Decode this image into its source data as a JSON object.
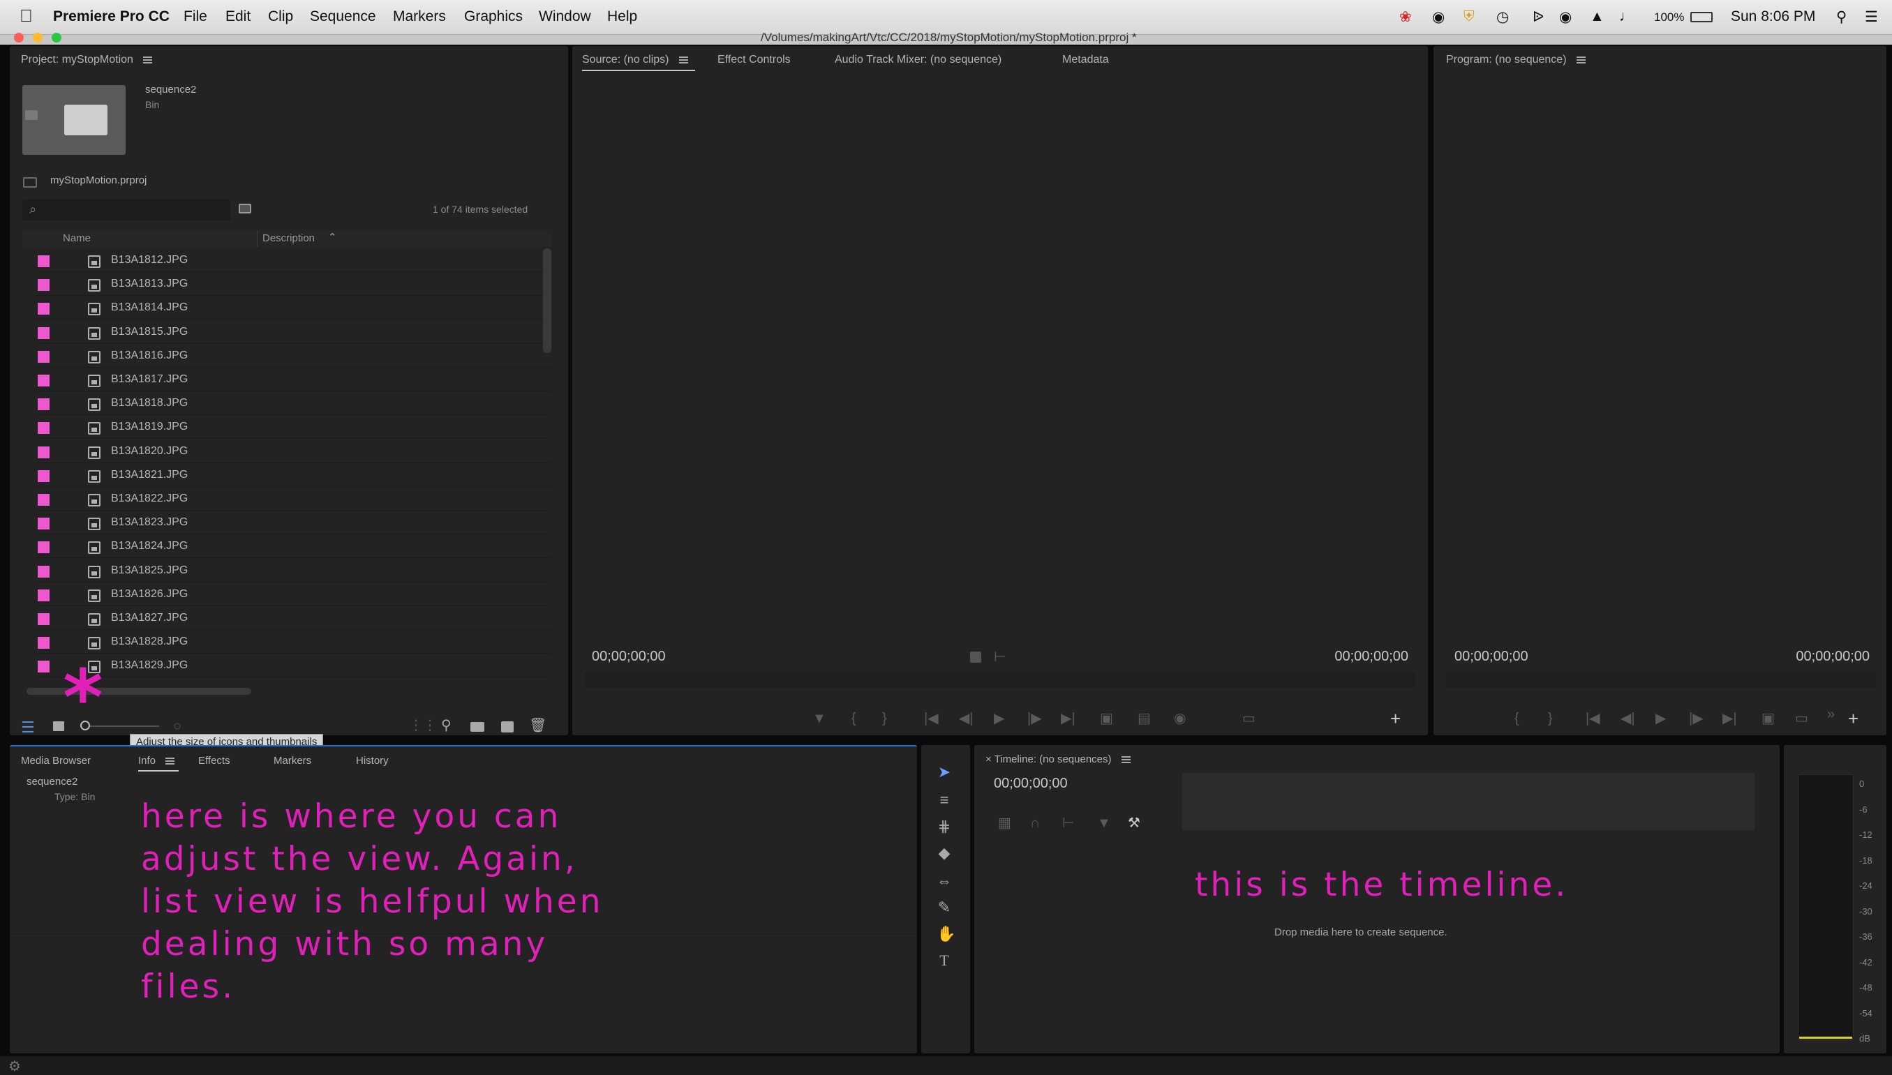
{
  "menubar": {
    "app_name": "Premiere Pro CC",
    "items": [
      "File",
      "Edit",
      "Clip",
      "Sequence",
      "Markers",
      "Graphics",
      "Window",
      "Help"
    ],
    "battery": "100%",
    "clock": "Sun 8:06 PM"
  },
  "window": {
    "title": "/Volumes/makingArt/Vtc/CC/2018/myStopMotion/myStopMotion.prproj *"
  },
  "project_panel": {
    "title": "Project: myStopMotion",
    "bin_name": "sequence2",
    "bin_type": "Bin",
    "project_file": "myStopMotion.prproj",
    "search_placeholder": "",
    "selection_count": "1 of 74 items selected",
    "columns": {
      "name": "Name",
      "description": "Description"
    },
    "items": [
      "B13A1812.JPG",
      "B13A1813.JPG",
      "B13A1814.JPG",
      "B13A1815.JPG",
      "B13A1816.JPG",
      "B13A1817.JPG",
      "B13A1818.JPG",
      "B13A1819.JPG",
      "B13A1820.JPG",
      "B13A1821.JPG",
      "B13A1822.JPG",
      "B13A1823.JPG",
      "B13A1824.JPG",
      "B13A1825.JPG",
      "B13A1826.JPG",
      "B13A1827.JPG",
      "B13A1828.JPG",
      "B13A1829.JPG"
    ],
    "label_color": "#ee58cf",
    "tooltip": "Adjust the size of icons and thumbnails"
  },
  "source_panel": {
    "tabs": [
      "Source: (no clips)",
      "Effect Controls",
      "Audio Track Mixer: (no sequence)",
      "Metadata"
    ],
    "timecode_in": "00;00;00;00",
    "timecode_out": "00;00;00;00"
  },
  "program_panel": {
    "title": "Program: (no sequence)",
    "timecode_in": "00;00;00;00",
    "timecode_out": "00;00;00;00"
  },
  "info_panel": {
    "tabs": [
      "Media Browser",
      "Info",
      "Effects",
      "Markers",
      "History"
    ],
    "selected_name": "sequence2",
    "selected_type": "Type: Bin"
  },
  "timeline_panel": {
    "title": "Timeline: (no sequences)",
    "timecode": "00;00;00;00",
    "drop_hint": "Drop media here to create sequence."
  },
  "audio_meter": {
    "scale": [
      "0",
      "-6",
      "-12",
      "-18",
      "-24",
      "-30",
      "-36",
      "-42",
      "-48",
      "-54",
      "dB"
    ]
  },
  "annotations": {
    "asterisk": "*",
    "view_note": [
      "here is where you can",
      "adjust the view. Again,",
      "list view is helfpul when",
      "dealing with so many",
      "files."
    ],
    "timeline_note": "this is the timeline.",
    "color": "#e020b8"
  }
}
